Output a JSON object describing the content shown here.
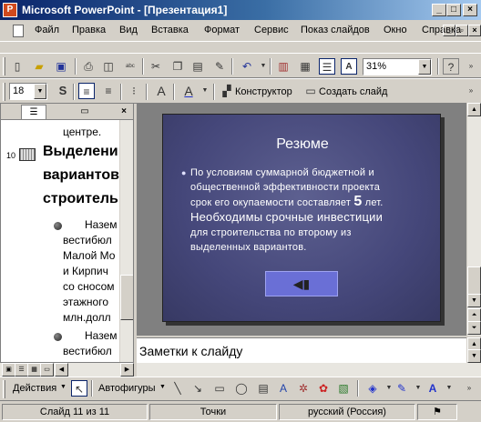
{
  "window": {
    "title": "Microsoft PowerPoint - [Презентация1]",
    "app_icon": "P"
  },
  "menu": {
    "items": [
      "Файл",
      "Правка",
      "Вид",
      "Вставка",
      "Формат",
      "Сервис",
      "Показ слайдов",
      "Окно",
      "Справка"
    ]
  },
  "toolbar": {
    "zoom": "31%",
    "font_size": "18",
    "designer_label": "Конструктор",
    "new_slide_label": "Создать слайд"
  },
  "outline": {
    "line_prev": "центре.",
    "slide_number": "10",
    "heading_lines": [
      "Выделени",
      "вариантов",
      "строитель"
    ],
    "bullet1_lines": [
      "Назем",
      "вестибюл",
      "Малой Мо",
      "и Кирпич",
      "со сносом",
      "этажного",
      "млн.долл"
    ],
    "bullet2_lines": [
      "Назем",
      "вестибюл"
    ]
  },
  "slide": {
    "title": "Резюме",
    "body_line1": "По условиям суммарной бюджетной и",
    "body_line2": "общественной эффективности проекта",
    "body_line3a": "срок его окупаемости составляет",
    "body_number": "5",
    "body_line3b": "лет.",
    "body_line4a": "Необходимы",
    "body_line4b": "срочные инвестиции",
    "body_line5": "для строительства по второму из",
    "body_line6": "выделенных вариантов."
  },
  "notes": {
    "placeholder": "Заметки к слайду"
  },
  "drawing": {
    "actions_label": "Действия",
    "autoshapes_label": "Автофигуры"
  },
  "status": {
    "slide": "Слайд 11 из 11",
    "design": "Точки",
    "language": "русский (Россия)"
  }
}
